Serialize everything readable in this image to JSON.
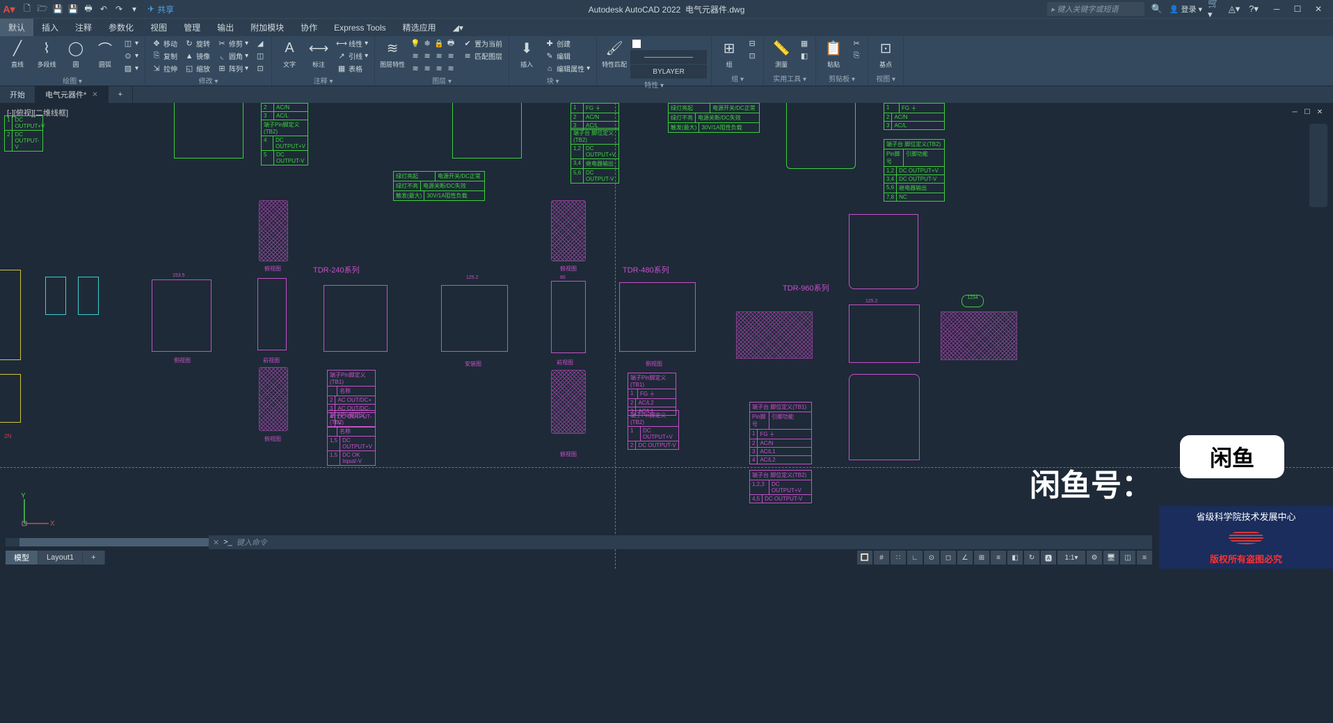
{
  "app": {
    "title": "Autodesk AutoCAD 2022",
    "filename": "电气元器件.dwg",
    "search_placeholder": "键入关键字或短语",
    "login": "登录",
    "share": "共享"
  },
  "menus": [
    "默认",
    "插入",
    "注释",
    "参数化",
    "视图",
    "管理",
    "输出",
    "附加模块",
    "协作",
    "Express Tools",
    "精选应用"
  ],
  "ribbon": {
    "draw": {
      "label": "绘图 ▾",
      "line": "直线",
      "polyline": "多段线",
      "circle": "圆",
      "arc": "圆弧"
    },
    "modify": {
      "label": "修改 ▾",
      "move": "移动",
      "rotate": "旋转",
      "trim": "修剪",
      "copy": "复制",
      "mirror": "镜像",
      "fillet": "圆角",
      "stretch": "拉伸",
      "scale": "缩放",
      "array": "阵列"
    },
    "annotation": {
      "label": "注释 ▾",
      "text": "文字",
      "dim": "标注",
      "leader": "引线",
      "table": "表格",
      "linear": "线性"
    },
    "layers": {
      "label": "图层 ▾",
      "props": "图层特性",
      "current": "置为当前",
      "match": "匹配图层"
    },
    "block": {
      "label": "块 ▾",
      "insert": "插入",
      "create": "创建",
      "edit": "编辑",
      "editattr": "编辑属性"
    },
    "properties": {
      "label": "特性 ▾",
      "match": "特性匹配",
      "bylayer": "BYLAYER"
    },
    "group": {
      "label": "组 ▾",
      "group": "组"
    },
    "utils": {
      "label": "实用工具 ▾",
      "measure": "测量"
    },
    "clipboard": {
      "label": "剪贴板 ▾",
      "paste": "粘贴"
    },
    "view": {
      "label": "视图 ▾",
      "base": "基点"
    }
  },
  "tabs": {
    "start": "开始",
    "file": "电气元器件*"
  },
  "viewport": {
    "label": "[-][俯视][二维线框]"
  },
  "drawing": {
    "series": {
      "tdr240": "TDR-240系列",
      "tdr480": "TDR-480系列",
      "tdr960": "TDR-960系列"
    },
    "view_labels": {
      "front": "前视图",
      "side": "侧视图",
      "top": "俯视图",
      "install": "安装图"
    },
    "terminals": {
      "tb1_def": "端子台 脚位定义(TB1)",
      "tb2_def": "端子台 脚位定义(TB2)",
      "pin_def": "端子Pin脚定义(TB1)",
      "pin_def2": "端子Pin脚定义(TB2)",
      "pin": "Pin脚号",
      "func": "引脚功能",
      "fg": "FG ⏚",
      "acn": "AC/N",
      "acl": "AC/L",
      "acl1": "AC/L1",
      "acl2": "AC/L2",
      "dcout_pos": "DC OUTPUT+V",
      "dcout_neg": "DC OUTPUT-V",
      "relay": "继电器输出",
      "nc": "NC",
      "name": "名称"
    },
    "notes": {
      "green_led": "绿灯亮起",
      "power_ok": "电源开关/DC正常",
      "green_off": "绿灯不亮",
      "power_fail": "电源关断/DC失效",
      "relay_max": "触发(最大)",
      "rating": "30V/1A阻性负载"
    },
    "dims": {
      "d1252": "125.2",
      "d1535": "153.5",
      "d85": "85"
    }
  },
  "commandline": {
    "prompt": ">_",
    "placeholder": "键入命令"
  },
  "layouts": [
    "模型",
    "Layout1"
  ],
  "watermark": {
    "logo": "闲鱼",
    "account": "闲鱼号：",
    "center": "省级科学院技术发展中心",
    "copyright": "版权所有盗图必究"
  }
}
